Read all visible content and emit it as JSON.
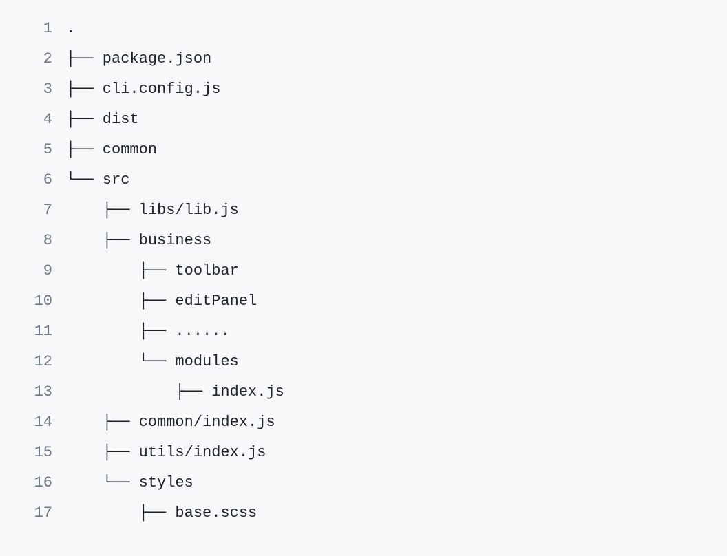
{
  "lines": [
    {
      "num": "1",
      "text": "."
    },
    {
      "num": "2",
      "text": "├── package.json"
    },
    {
      "num": "3",
      "text": "├── cli.config.js"
    },
    {
      "num": "4",
      "text": "├── dist"
    },
    {
      "num": "5",
      "text": "├── common"
    },
    {
      "num": "6",
      "text": "└── src"
    },
    {
      "num": "7",
      "text": "    ├── libs/lib.js"
    },
    {
      "num": "8",
      "text": "    ├── business"
    },
    {
      "num": "9",
      "text": "        ├── toolbar"
    },
    {
      "num": "10",
      "text": "        ├── editPanel"
    },
    {
      "num": "11",
      "text": "        ├── ......"
    },
    {
      "num": "12",
      "text": "        └── modules"
    },
    {
      "num": "13",
      "text": "            ├── index.js"
    },
    {
      "num": "14",
      "text": "    ├── common/index.js"
    },
    {
      "num": "15",
      "text": "    ├── utils/index.js"
    },
    {
      "num": "16",
      "text": "    └── styles"
    },
    {
      "num": "17",
      "text": "        ├── base.scss"
    }
  ]
}
